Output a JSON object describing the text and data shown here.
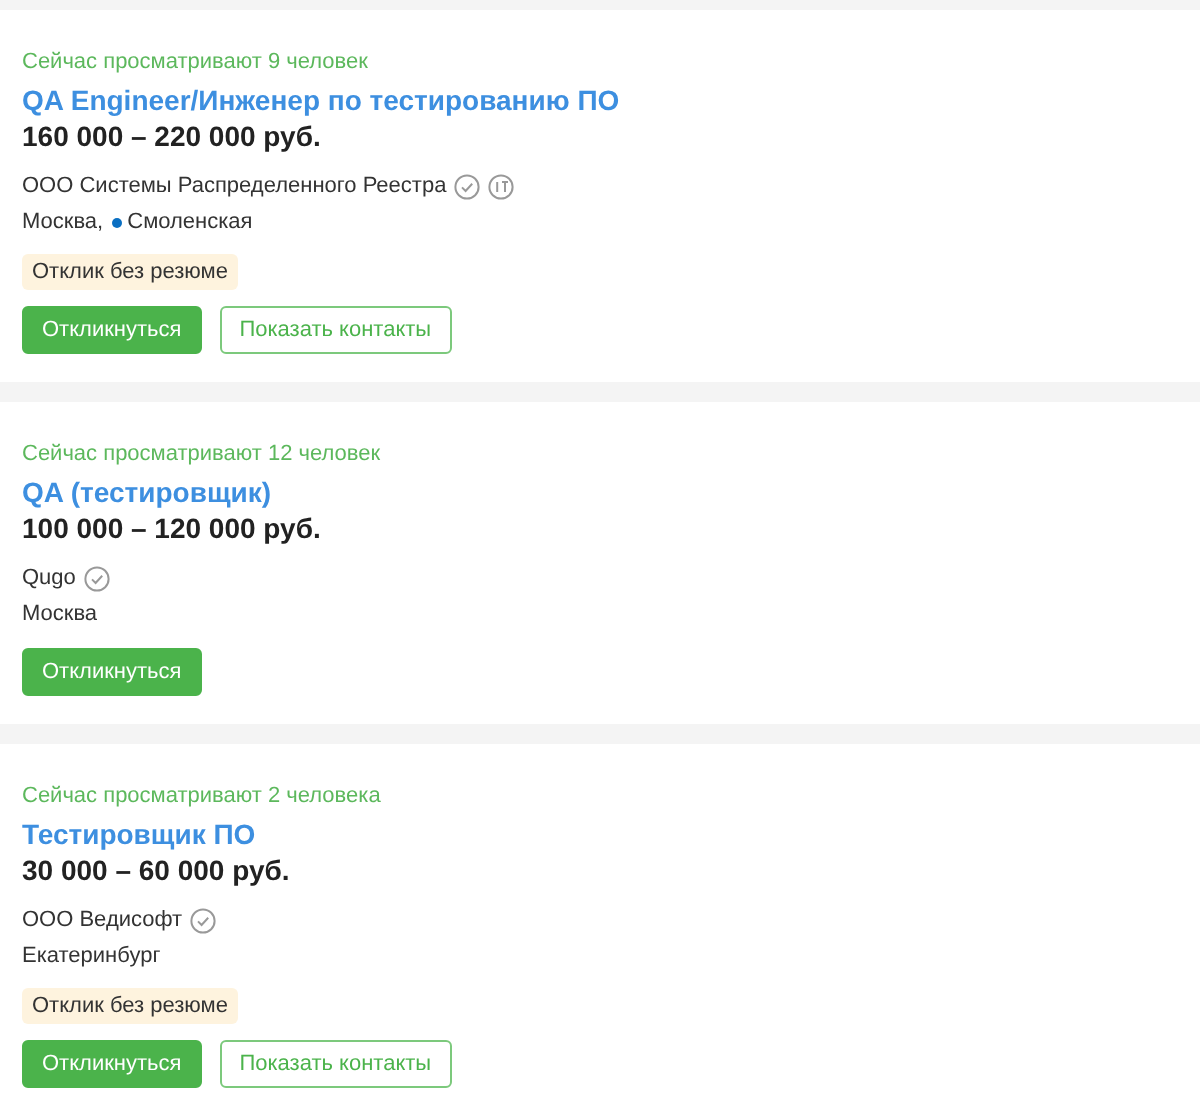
{
  "vacancies": [
    {
      "viewers": "Сейчас просматривают 9 человек",
      "title": "QA Engineer/Инженер по тестированию ПО",
      "salary": "160 000 – 220 000 руб.",
      "company": "ООО Системы Распределенного Реестра",
      "verified": true,
      "it_accredited": true,
      "city": "Москва,",
      "metro": {
        "name": "Смоленская",
        "color": "#0a6fc2"
      },
      "badge": "Отклик без резюме",
      "buttons": [
        {
          "kind": "primary",
          "label": "Откликнуться"
        },
        {
          "kind": "outline",
          "label": "Показать контакты"
        }
      ]
    },
    {
      "viewers": "Сейчас просматривают 12 человек",
      "title": "QA (тестировщик)",
      "salary": "100 000 – 120 000 руб.",
      "company": "Qugo",
      "verified": true,
      "it_accredited": false,
      "city": "Москва",
      "buttons": [
        {
          "kind": "primary",
          "label": "Откликнуться"
        }
      ]
    },
    {
      "viewers": "Сейчас просматривают 2 человека",
      "title": "Тестировщик ПО",
      "salary": "30 000 – 60 000 руб.",
      "company": "ООО Ведисофт",
      "verified": true,
      "it_accredited": false,
      "city": "Екатеринбург",
      "badge": "Отклик без резюме",
      "buttons": [
        {
          "kind": "primary",
          "label": "Откликнуться"
        },
        {
          "kind": "outline",
          "label": "Показать контакты"
        }
      ]
    }
  ]
}
